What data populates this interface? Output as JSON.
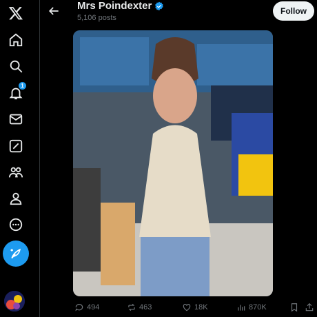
{
  "profile": {
    "name": "Mrs Poindexter",
    "posts": "5,106 posts",
    "follow_label": "Follow"
  },
  "nav": {
    "notifications_badge": "1",
    "items": [
      "x-logo-icon",
      "home-icon",
      "explore-icon",
      "notifications-icon",
      "messages-icon",
      "grok-icon",
      "communities-icon",
      "profile-icon",
      "more-icon"
    ]
  },
  "actions": {
    "replies": "494",
    "reposts": "463",
    "likes": "18K",
    "views": "870K"
  },
  "colors": {
    "accent": "#1d9bf0",
    "background": "#000000",
    "muted": "#71767b"
  }
}
